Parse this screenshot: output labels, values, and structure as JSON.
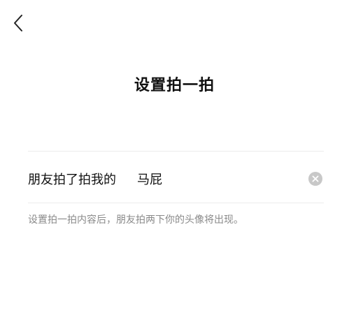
{
  "header": {
    "back_icon": "chevron-left-icon"
  },
  "page": {
    "title": "设置拍一拍"
  },
  "input": {
    "prefix": "朋友拍了拍我的",
    "value": "马屁",
    "clear_icon": "clear-circle-icon"
  },
  "hint": {
    "text": "设置拍一拍内容后，朋友拍两下你的头像将出现。"
  }
}
